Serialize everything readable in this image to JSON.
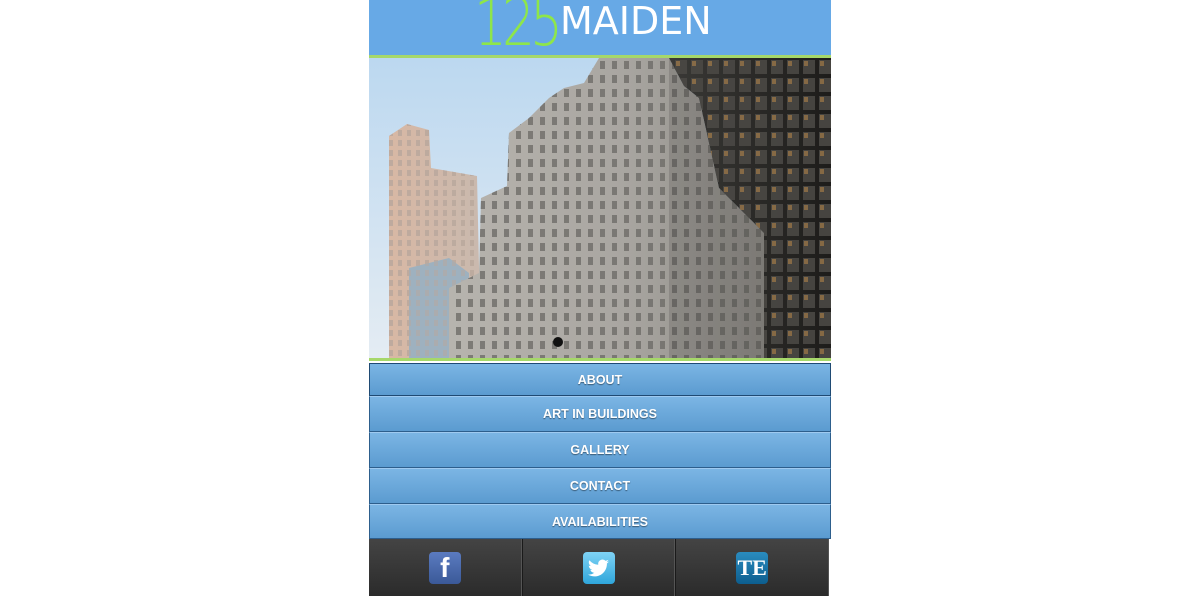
{
  "header": {
    "logo_number": "125",
    "logo_name": "MAIDEN",
    "colors": {
      "background": "#67a9e6",
      "accent": "#a6d86a",
      "number": "#8ee64a"
    }
  },
  "hero": {
    "slide_indicator": "current-slide"
  },
  "nav": {
    "items": [
      {
        "label": "ABOUT"
      },
      {
        "label": "ART IN BUILDINGS"
      },
      {
        "label": "GALLERY"
      },
      {
        "label": "CONTACT"
      },
      {
        "label": "AVAILABILITIES"
      }
    ]
  },
  "social": {
    "facebook": {
      "glyph": "f",
      "icon": "facebook-icon"
    },
    "twitter": {
      "glyph": "🐦",
      "icon": "twitter-icon"
    },
    "te": {
      "glyph": "TE",
      "icon": "te-icon"
    }
  }
}
